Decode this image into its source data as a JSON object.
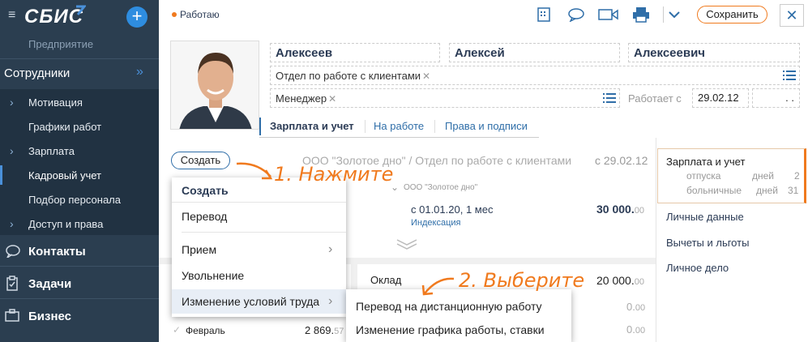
{
  "sidebar": {
    "logo": "СБИС",
    "company": "Предприятие",
    "section": "Сотрудники",
    "items": [
      {
        "label": "Мотивация",
        "has_children": true
      },
      {
        "label": "Графики работ",
        "has_children": false
      },
      {
        "label": "Зарплата",
        "has_children": true
      },
      {
        "label": "Кадровый учет",
        "has_children": false,
        "active": true
      },
      {
        "label": "Подбор персонала",
        "has_children": false
      },
      {
        "label": "Доступ и права",
        "has_children": true
      }
    ],
    "sections": [
      {
        "label": "Контакты",
        "icon": "chat-icon"
      },
      {
        "label": "Задачи",
        "icon": "clipboard-icon"
      },
      {
        "label": "Бизнес",
        "icon": "briefcase-icon"
      }
    ]
  },
  "header": {
    "status": "Работаю",
    "save_label": "Сохранить"
  },
  "employee": {
    "last_name": "Алексеев",
    "first_name": "Алексей",
    "middle_name": "Алексеевич",
    "department": "Отдел по работе с клиентами",
    "position": "Менеджер",
    "works_since_label": "Работает с",
    "works_since": "29.02.12",
    "works_until": ". ."
  },
  "tabs": [
    "Зарплата и учет",
    "На работе",
    "Права и подписи"
  ],
  "content": {
    "create_label": "Создать",
    "org_line": "ООО \"Золотое дно\" / Отдел по работе с клиентами",
    "org_date": "с 29.02.12",
    "org_small": "ООО \"Золотое дно\"",
    "period": "с 01.01.20, 1 мес",
    "period_note": "Индексация",
    "amount": "30 000.",
    "amount_dec": "00",
    "salary_label": "Оклад",
    "salary_amount": "20 000.",
    "salary_dec": "00",
    "row1_val": "0.",
    "row1_dec": "00",
    "row2_val": "0.",
    "row2_dec": "00",
    "month": "Февраль",
    "month_amount": "2 869.",
    "month_dec": "57"
  },
  "menu": {
    "title": "Создать",
    "items": [
      "Перевод",
      "Прием",
      "Увольнение",
      "Изменение условий труда"
    ]
  },
  "submenu": {
    "items": [
      "Перевод на дистанционную работу",
      "Изменение графика работы, ставки"
    ]
  },
  "annotations": {
    "step1": "1. Нажмите",
    "step2": "2. Выберите"
  },
  "right_panel": {
    "active_title": "Зарплата и учет",
    "vacation_label": "отпуска",
    "vacation_unit": "дней",
    "vacation_value": "2",
    "sick_label": "больничные",
    "sick_unit": "дней",
    "sick_value": "31",
    "links": [
      "Личные данные",
      "Вычеты и льготы",
      "Личное дело"
    ]
  },
  "colors": {
    "sidebar_bg": "#2b3e50",
    "accent": "#2f6ea8",
    "annotation": "#f07a1e"
  }
}
